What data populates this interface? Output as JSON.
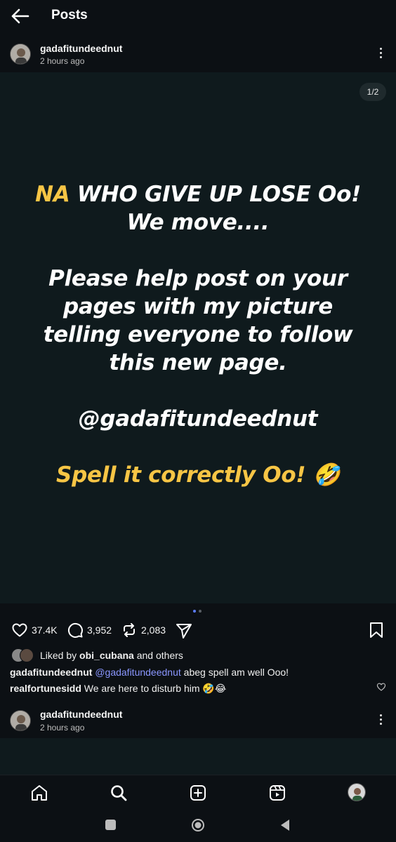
{
  "header": {
    "title": "Posts",
    "back_icon": "arrow-left-icon"
  },
  "post": {
    "username": "gadafitundeednut",
    "time": "2 hours ago",
    "counter": "1/2",
    "image_text": {
      "line1_highlight": "NA",
      "line1_rest": " WHO GIVE UP LOSE Oo!",
      "line2": "We move....",
      "line3": "Please help post on your",
      "line4": "pages with my picture",
      "line5": "telling everyone to follow",
      "line6": "this new page.",
      "line7": "@gadafitundeednut",
      "line8": "Spell it correctly Oo! 🤣"
    },
    "likes": "37.4K",
    "comments": "3,952",
    "reposts": "2,083",
    "liked_by_prefix": "Liked by ",
    "liked_by_user": "obi_cubana",
    "liked_by_suffix": " and others",
    "caption_user": "gadafitundeednut",
    "caption_mention": "@gadafitundeednut",
    "caption_text": " abeg spell am well Ooo!",
    "comment_user": "realfortunesidd",
    "comment_text": " We are here to disturb him 🤣😂"
  },
  "next_post": {
    "username": "gadafitundeednut",
    "time": "2 hours ago"
  },
  "colors": {
    "background": "#0c1014",
    "image_background": "#0f1a1d",
    "highlight_yellow": "#f7c545",
    "mention_blue": "#8a96ff",
    "active_dot": "#5b7cff"
  },
  "nav": [
    "home-icon",
    "search-icon",
    "create-icon",
    "reels-icon",
    "profile-avatar"
  ],
  "system_nav": [
    "recents-square-icon",
    "home-circle-icon",
    "back-triangle-icon"
  ]
}
